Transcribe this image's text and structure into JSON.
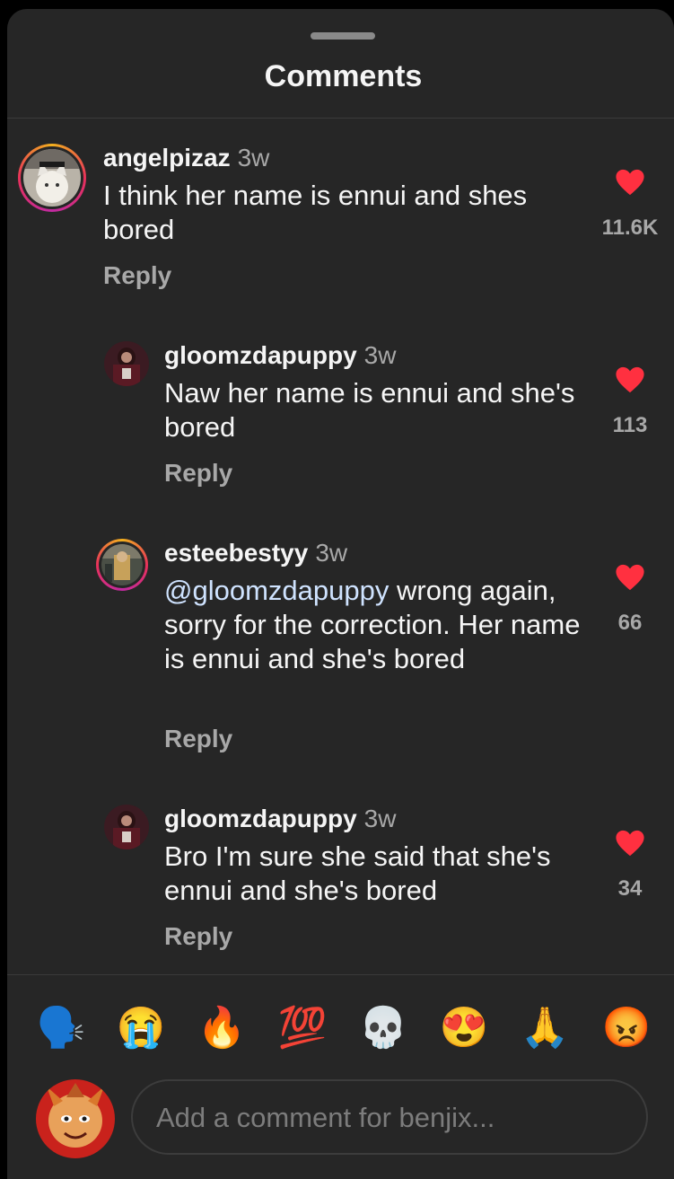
{
  "sheet": {
    "title": "Comments"
  },
  "comments": [
    {
      "username": "angelpizaz",
      "time": "3w",
      "text": "I think her name is ennui and shes bored",
      "reply_label": "Reply",
      "likes": "11.6K",
      "has_story_ring": true
    },
    {
      "username": "gloomzdapuppy",
      "time": "3w",
      "text": "Naw her name is ennui and she's bored",
      "reply_label": "Reply",
      "likes": "113",
      "has_story_ring": false
    },
    {
      "username": "esteebestyy",
      "time": "3w",
      "mention": "@gloomzdapuppy",
      "text": "wrong again, sorry for the correction. Her name is ennui and she's bored",
      "reply_label": "Reply",
      "likes": "66",
      "has_story_ring": true
    },
    {
      "username": "gloomzdapuppy",
      "time": "3w",
      "text": "Bro I'm sure she said that she's ennui and she's bored",
      "reply_label": "Reply",
      "likes": "34",
      "has_story_ring": false
    }
  ],
  "quick_reactions": [
    "🗣️",
    "😭",
    "🔥",
    "💯",
    "💀",
    "😍",
    "🙏",
    "😡"
  ],
  "composer": {
    "placeholder": "Add a comment for benjix..."
  },
  "colors": {
    "background": "#262626",
    "heart": "#ff3040",
    "muted_text": "#a8a8a8",
    "mention": "#cfe3ff"
  },
  "icons": {
    "like": "heart-filled-icon"
  }
}
